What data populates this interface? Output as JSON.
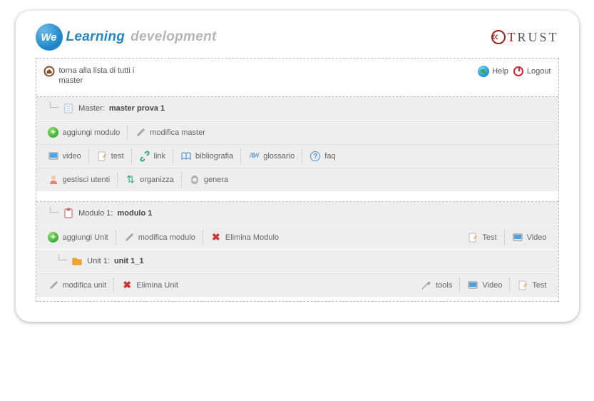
{
  "brand": {
    "we": "We",
    "learning": "Learning",
    "dev": "development",
    "trust_t": "T",
    "trust_rest": "RUST"
  },
  "top": {
    "home": "torna alla lista di tutti i master",
    "help": "Help",
    "logout": "Logout"
  },
  "master": {
    "label": "Master:",
    "name": "master prova 1",
    "actions": {
      "add_module": "aggiungi modulo",
      "edit_master": "modifica master",
      "video": "video",
      "test": "test",
      "link": "link",
      "biblio": "bibliografia",
      "glossary": "glossario",
      "faq": "faq",
      "users": "gestisci utenti",
      "organize": "organizza",
      "generate": "genera"
    }
  },
  "module": {
    "label": "Modulo 1:",
    "name": "modulo 1",
    "actions": {
      "add_unit": "aggiungi Unit",
      "edit_module": "modifica modulo",
      "delete_module": "Elimina Modulo",
      "test": "Test",
      "video": "Video"
    }
  },
  "unit": {
    "label": "Unit 1:",
    "name": "unit 1_1",
    "actions": {
      "edit_unit": "modifica unit",
      "delete_unit": "Elimina Unit",
      "tools": "tools",
      "video": "Video",
      "test": "Test"
    }
  }
}
